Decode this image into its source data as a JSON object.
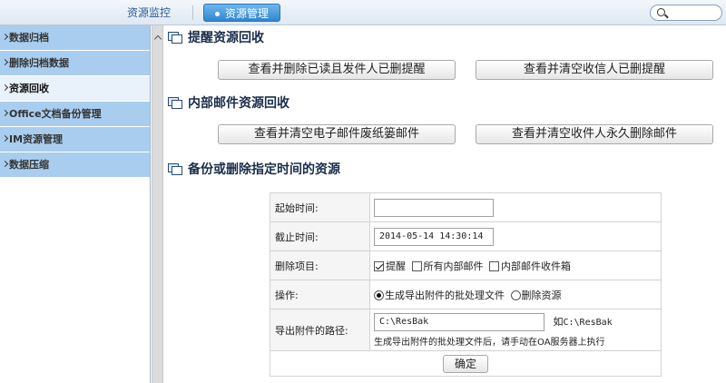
{
  "topbar": {
    "tabs": [
      {
        "label": "资源监控"
      },
      {
        "label": "资源管理"
      }
    ]
  },
  "sidebar": {
    "items": [
      {
        "label": "数据归档"
      },
      {
        "label": "删除归档数据"
      },
      {
        "label": "资源回收"
      },
      {
        "label": "Office文档备份管理"
      },
      {
        "label": "IM资源管理"
      },
      {
        "label": "数据压缩"
      }
    ],
    "active_index": 2
  },
  "sections": {
    "reminder": {
      "title": "提醒资源回收",
      "buttons": [
        "查看并删除已读且发件人已删提醒",
        "查看并清空收信人已删提醒"
      ]
    },
    "internal_mail": {
      "title": "内部邮件资源回收",
      "buttons": [
        "查看并清空电子邮件废纸篓邮件",
        "查看并清空收件人永久删除邮件"
      ]
    },
    "backup": {
      "title": "备份或删除指定时间的资源"
    }
  },
  "form": {
    "start_label": "起始时间:",
    "start_value": "",
    "end_label": "截止时间:",
    "end_value": "2014-05-14 14:30:14",
    "items_label": "删除项目:",
    "items": [
      {
        "label": "提醒",
        "checked": true
      },
      {
        "label": "所有内部邮件",
        "checked": false
      },
      {
        "label": "内部邮件收件箱",
        "checked": false
      }
    ],
    "operation_label": "操作:",
    "operations": [
      {
        "label": "生成导出附件的批处理文件",
        "selected": true
      },
      {
        "label": "删除资源",
        "selected": false
      }
    ],
    "path_label": "导出附件的路径:",
    "path_value": "C:\\ResBak",
    "path_example_prefix": "如",
    "path_example": "C:\\ResBak",
    "path_hint": "生成导出附件的批处理文件后，请手动在OA服务器上执行",
    "confirm_label": "确定"
  }
}
